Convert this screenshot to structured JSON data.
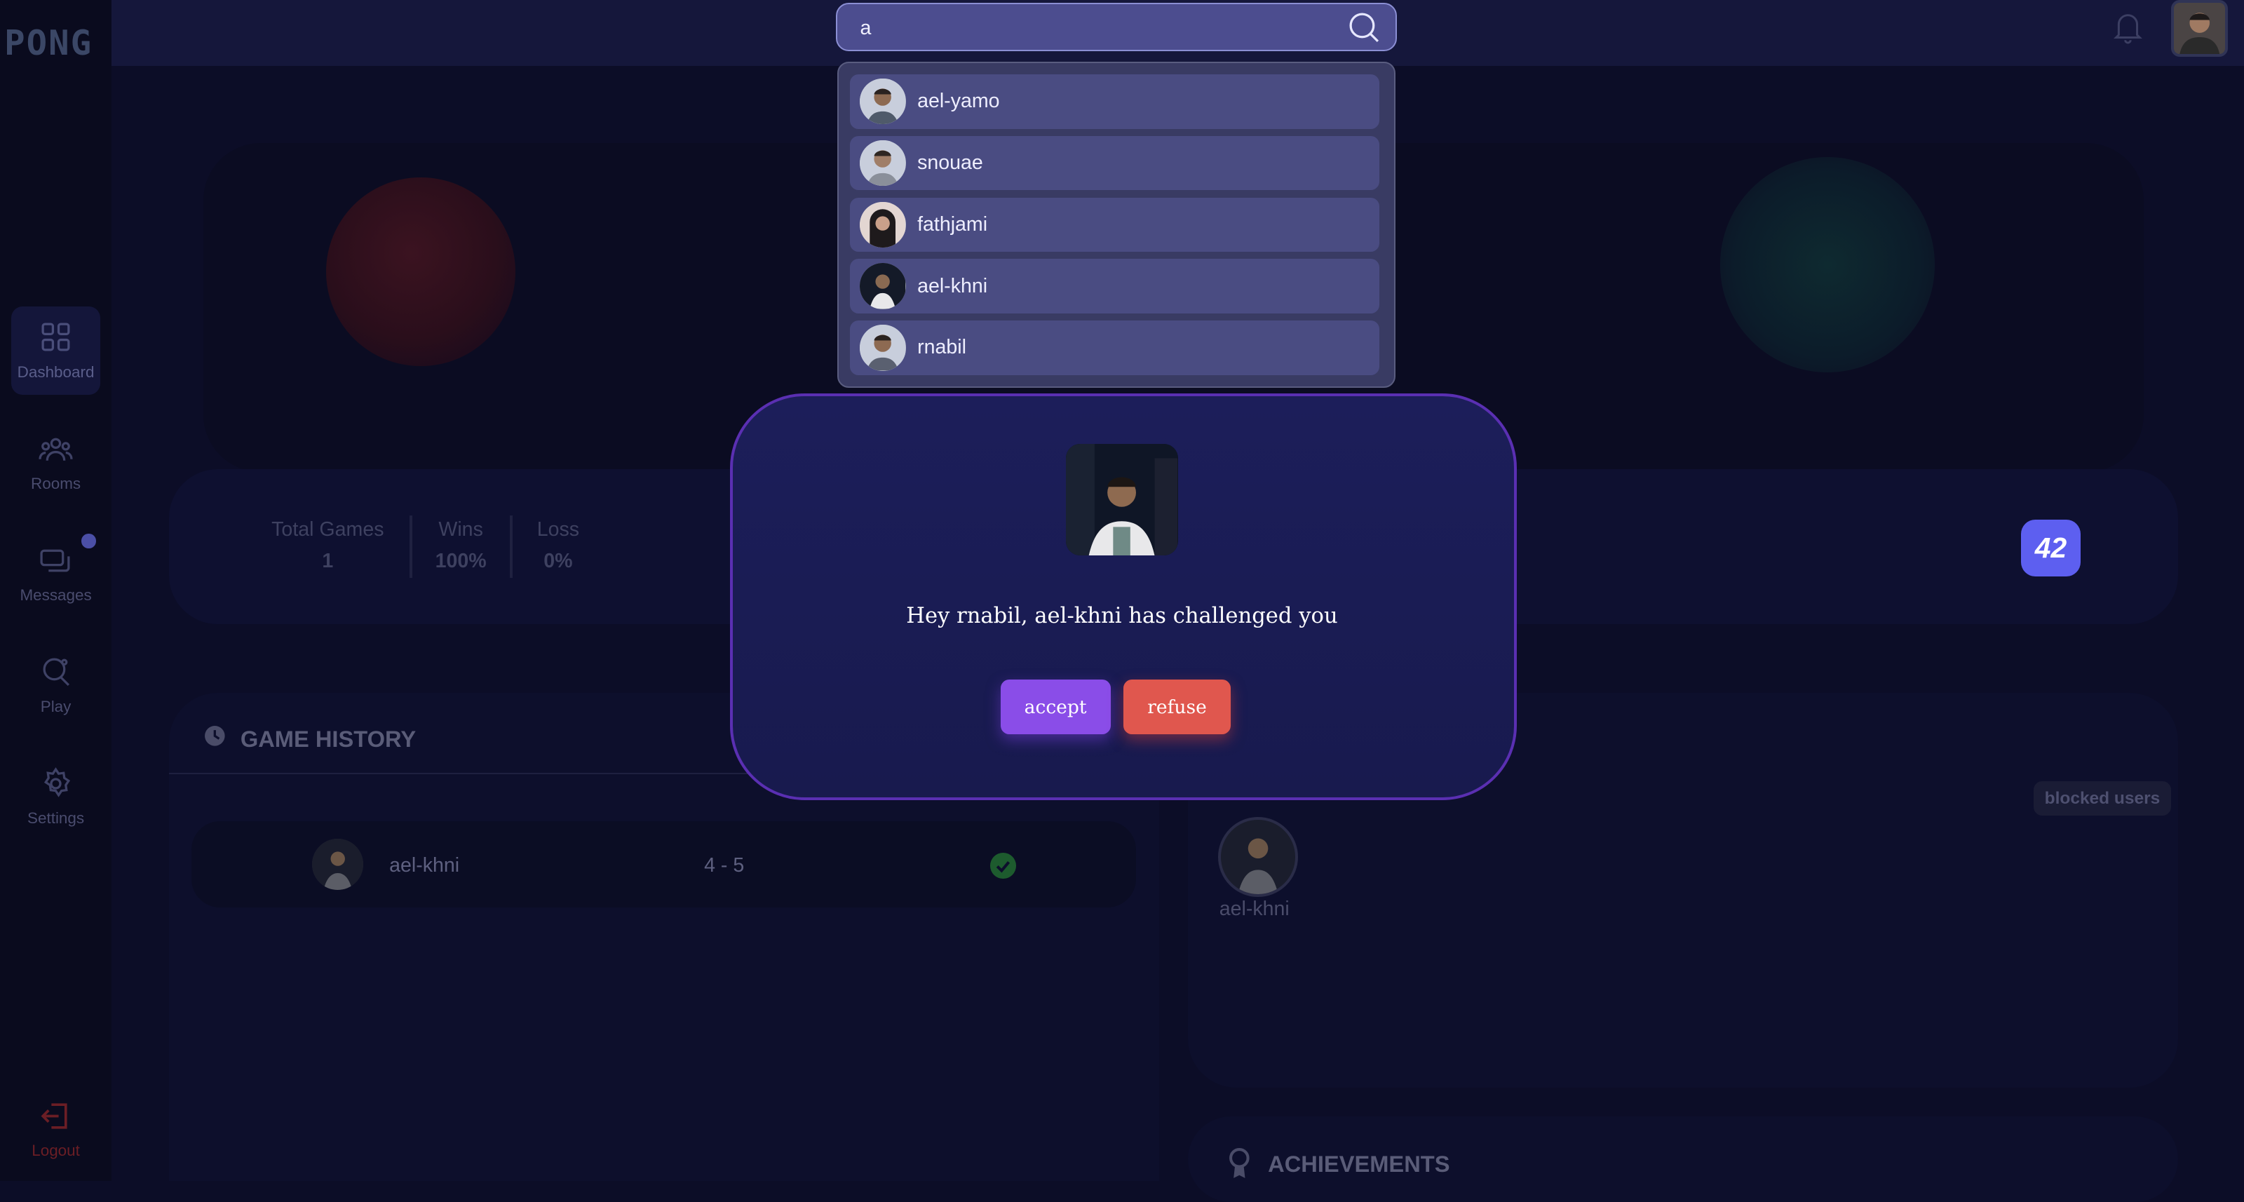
{
  "app": {
    "logo": "PONG"
  },
  "sidebar": {
    "items": [
      {
        "label": "Dashboard",
        "icon": "grid-icon",
        "active": true
      },
      {
        "label": "Rooms",
        "icon": "group-icon"
      },
      {
        "label": "Messages",
        "icon": "chat-icon"
      },
      {
        "label": "Play",
        "icon": "ping-pong-icon"
      },
      {
        "label": "Settings",
        "icon": "gear-icon"
      }
    ],
    "logout": "Logout"
  },
  "search": {
    "value": "a",
    "results": [
      "ael-yamo",
      "snouae",
      "fathjami",
      "ael-khni",
      "rnabil"
    ]
  },
  "stats": {
    "total_games_label": "Total Games",
    "total_games": "1",
    "wins_label": "Wins",
    "wins": "100%",
    "loss_label": "Loss",
    "loss": "0%",
    "badge": "42"
  },
  "history": {
    "title": "GAME HISTORY",
    "rows": [
      {
        "opponent": "ael-khni",
        "score": "4 - 5"
      }
    ]
  },
  "friends": {
    "blocked_button": "blocked users",
    "list": [
      "ael-khni"
    ]
  },
  "achievements": {
    "title": "ACHIEVEMENTS"
  },
  "modal": {
    "message": "Hey rnabil, ael-khni has challenged you",
    "accept": "accept",
    "refuse": "refuse"
  },
  "colors": {
    "accept": "#8a4de8",
    "refuse": "#e0574e",
    "badge": "#5d5ff0"
  }
}
